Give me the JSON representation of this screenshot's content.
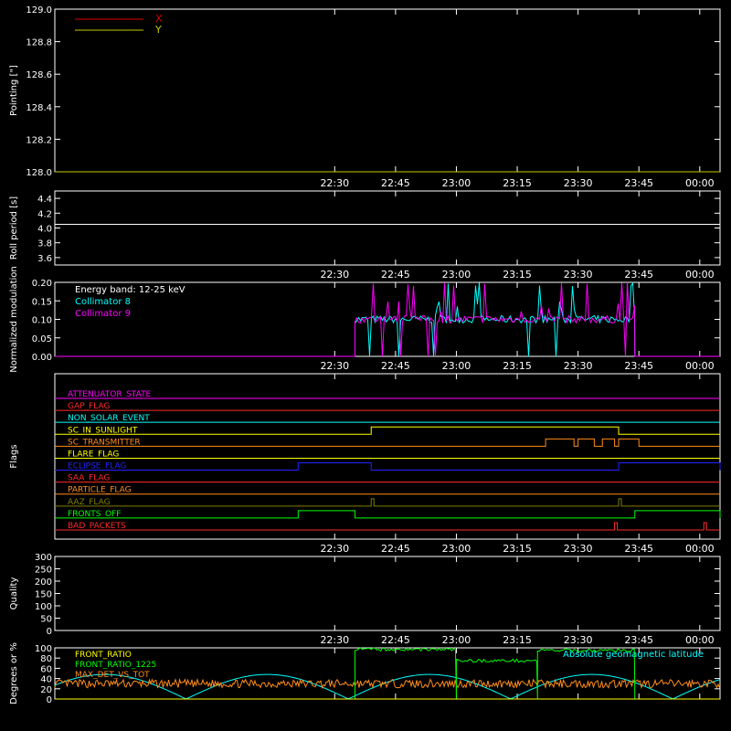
{
  "time_ticks": [
    "22:30",
    "22:45",
    "23:00",
    "23:15",
    "23:30",
    "23:45",
    "00:00"
  ],
  "colors": {
    "background": "#000000",
    "axis": "#ffffff",
    "pointing_x": "#e00000",
    "pointing_y": "#c8c800",
    "roll": "#ffffff",
    "collimator8": "#00ffff",
    "collimator9": "#ff00ff",
    "front_ratio": "#ffff00",
    "front_ratio_1225": "#00ff00",
    "max_det": "#ff8c1a",
    "geomag": "#00ffff"
  },
  "chart_data": [
    {
      "type": "line",
      "ylabel": "Pointing [\"]",
      "ylim": [
        128.0,
        129.0
      ],
      "yticks": [
        "129.0",
        "128.8",
        "128.6",
        "128.4",
        "128.2",
        "128.0"
      ],
      "legend": [
        "X",
        "Y"
      ],
      "legend_position": "top-left",
      "series": [
        {
          "name": "X",
          "values": [
            128.0,
            128.0
          ]
        },
        {
          "name": "Y",
          "values": [
            128.0,
            128.0
          ]
        }
      ]
    },
    {
      "type": "line",
      "ylabel": "Roll period [s]",
      "ylim": [
        3.5,
        4.5
      ],
      "yticks": [
        "4.4",
        "4.2",
        "4.0",
        "3.8",
        "3.6"
      ],
      "series": [
        {
          "name": "",
          "values": [
            4.05,
            4.05
          ]
        }
      ]
    },
    {
      "type": "line",
      "ylabel": "Normalized modulation",
      "ylim": [
        0.0,
        0.2
      ],
      "yticks": [
        "0.20",
        "0.15",
        "0.10",
        "0.05",
        "0.00"
      ],
      "annotation": "Energy band: 12-25 keV",
      "legend": [
        "Collimator 8",
        "Collimator 9"
      ],
      "legend_position": "top-left",
      "active_interval": [
        "22:35",
        "23:44"
      ],
      "series": [
        {
          "name": "Collimator 8",
          "level": 0.1
        },
        {
          "name": "Collimator 9",
          "level": 0.1
        }
      ]
    },
    {
      "type": "line",
      "ylabel": "Flags",
      "flags": [
        {
          "name": "ATTENUATOR_STATE",
          "color": "#ff00ff",
          "segments": []
        },
        {
          "name": "GAP_FLAG",
          "color": "#ff2a2a",
          "segments": []
        },
        {
          "name": "NON_SOLAR_EVENT",
          "color": "#00ffff",
          "segments": []
        },
        {
          "name": "SC_IN_SUNLIGHT",
          "color": "#ffff00",
          "segments": [
            [
              "22:39",
              "23:40"
            ]
          ]
        },
        {
          "name": "SC_TRANSMITTER",
          "color": "#ff8c1a",
          "segments": [
            [
              "23:22",
              "23:29"
            ],
            [
              "23:30",
              "23:34"
            ],
            [
              "23:36",
              "23:39"
            ],
            [
              "23:40",
              "23:45"
            ]
          ]
        },
        {
          "name": "FLARE_FLAG",
          "color": "#ffff00",
          "segments": []
        },
        {
          "name": "ECLIPSE_FLAG",
          "color": "#2222ff",
          "segments": [
            [
              "22:21",
              "22:39"
            ],
            [
              "23:40",
              "00:05"
            ]
          ]
        },
        {
          "name": "SAA_FLAG",
          "color": "#ff2a2a",
          "segments": []
        },
        {
          "name": "PARTICLE_FLAG",
          "color": "#ff8c1a",
          "segments": []
        },
        {
          "name": "AAZ_FLAG",
          "color": "#808000",
          "segments": [
            [
              "22:39",
              "22:39"
            ],
            [
              "23:40",
              "23:40"
            ]
          ]
        },
        {
          "name": "FRONTS_OFF",
          "color": "#00ff00",
          "segments": [
            [
              "22:21",
              "22:35"
            ],
            [
              "23:44",
              "00:05"
            ]
          ]
        },
        {
          "name": "BAD_PACKETS",
          "color": "#ff2a2a",
          "segments": [
            [
              "23:39",
              "23:39"
            ],
            [
              "00:01",
              "00:01"
            ]
          ]
        }
      ]
    },
    {
      "type": "line",
      "ylabel": "Quality",
      "ylim": [
        0,
        300
      ],
      "yticks": [
        "300",
        "250",
        "200",
        "150",
        "100",
        "50",
        "0"
      ],
      "series": []
    },
    {
      "type": "line",
      "ylabel": "Degrees or %",
      "ylim": [
        0,
        100
      ],
      "yticks": [
        "100",
        "80",
        "60",
        "40",
        "20",
        "0"
      ],
      "legend": [
        "FRONT_RATIO",
        "FRONT_RATIO_1225",
        "MAX_DET_VS_TOT"
      ],
      "legend_position": "top-left",
      "annotation": "Absolute geomagnetic latitude",
      "series": [
        {
          "name": "FRONT_RATIO",
          "values": [
            0,
            0
          ]
        },
        {
          "name": "FRONT_RATIO_1225",
          "segments": [
            {
              "x": [
                "22:35",
                "23:00"
              ],
              "value": 97
            },
            {
              "x": [
                "23:00",
                "23:20"
              ],
              "value": 75
            },
            {
              "x": [
                "23:20",
                "23:44"
              ],
              "value": 95
            }
          ]
        },
        {
          "name": "MAX_DET_VS_TOT",
          "level": 30
        },
        {
          "name": "Absolute geomagnetic latitude",
          "peaks": [
            48,
            48
          ],
          "troughs": [
            0,
            0
          ]
        }
      ]
    }
  ]
}
